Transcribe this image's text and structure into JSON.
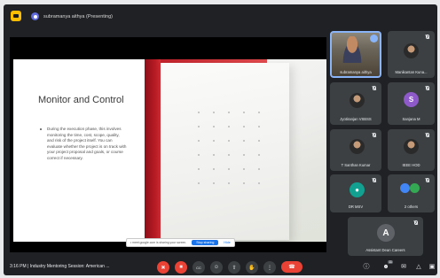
{
  "header": {
    "presenter_label": "subramanya aithya (Presenting)"
  },
  "slide": {
    "title": "Monitor and Control",
    "body": "During the execution phase, this involves monitoring the time, cost, scope, quality, and risk of the project itself. You can evaluate whether the project is on track with your project proposal and goals, or course correct if necessary."
  },
  "share_banner": {
    "text": "• meet.google.com is sharing your screen.",
    "stop_label": "Stop sharing",
    "hide_label": "Hide"
  },
  "participants": [
    {
      "name": "subramanya aithya",
      "kind": "presenter"
    },
    {
      "name": "Manikantan Kuna...",
      "kind": "photo"
    },
    {
      "name": "Jyotiranjan VSBSS",
      "kind": "photo"
    },
    {
      "name": "Sanjana M",
      "kind": "letter",
      "letter": "S",
      "color": "#8e59c9"
    },
    {
      "name": "T Santhan Kumar",
      "kind": "photo"
    },
    {
      "name": "IEEE HOD",
      "kind": "photo"
    },
    {
      "name": "DR MSV",
      "kind": "icon",
      "color": "#12a090"
    },
    {
      "name": "2 others",
      "kind": "group"
    },
    {
      "name": "Assistant Dean Careers",
      "kind": "letter",
      "letter": "A",
      "color": "#5f6368"
    }
  ],
  "footer": {
    "clock": "3:16 PM | Industry Mentoring Session: American ..."
  },
  "controls": {
    "mic": "✖",
    "camera": "■",
    "captions": "CC",
    "emoji": "☺",
    "present": "⇧",
    "hand": "✋",
    "more": "⋮",
    "end": "☎",
    "info": "ⓘ",
    "people": "☻",
    "people_badge": "11",
    "chat": "✉",
    "activities": "△",
    "lock": "▣"
  },
  "colors": {
    "background": "#202124",
    "tile": "#3c4043",
    "accent": "#8ab4f8",
    "danger": "#ea4335"
  }
}
